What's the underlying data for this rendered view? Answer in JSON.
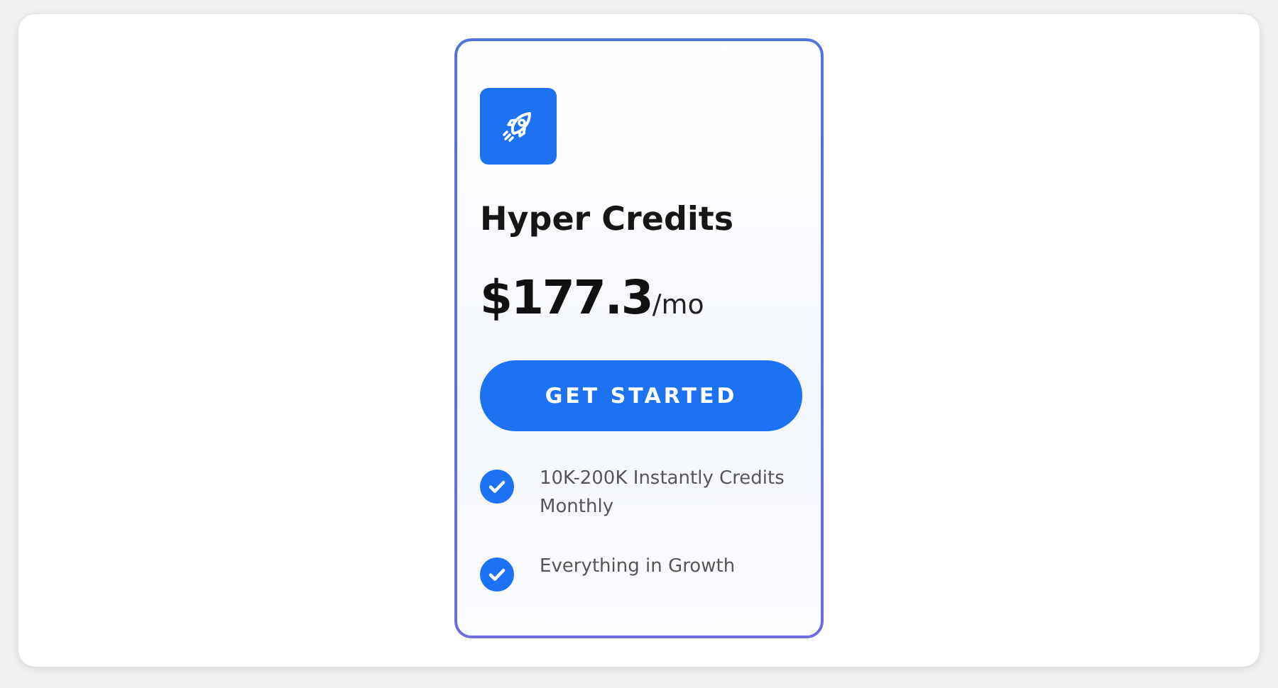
{
  "plan": {
    "title": "Hyper Credits",
    "price": "$177.3",
    "period": "/mo",
    "button": "GET STARTED",
    "features": [
      "10K-200K Instantly Credits Monthly",
      "Everything in Growth"
    ]
  }
}
